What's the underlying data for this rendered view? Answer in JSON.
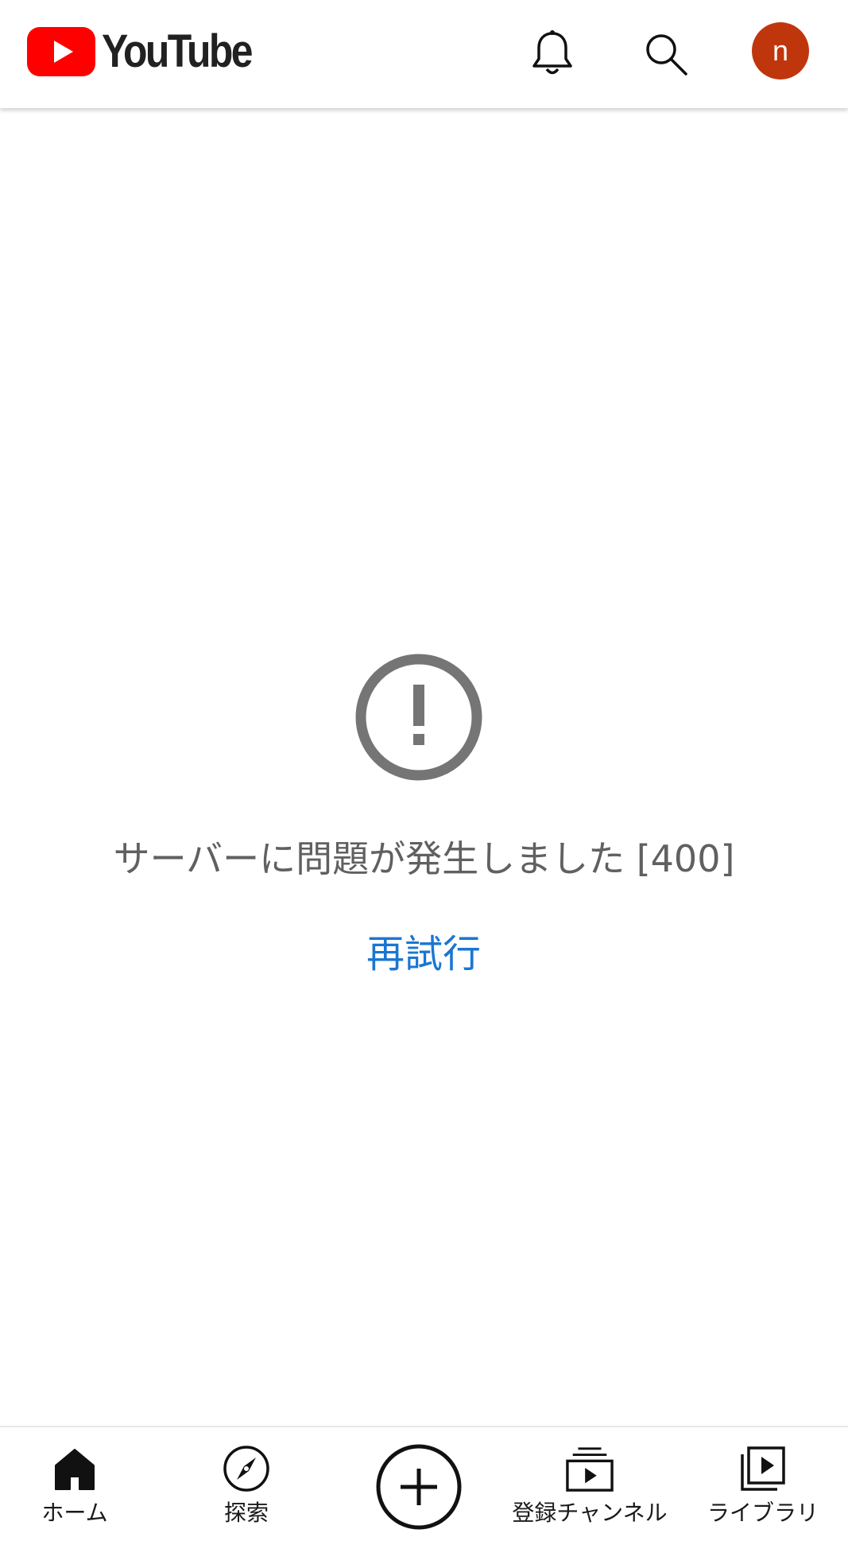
{
  "header": {
    "logo_text": "YouTube",
    "avatar_initial": "n",
    "brand_color": "#ff0000",
    "avatar_color": "#c0360c",
    "icons": [
      "bell-icon",
      "search-icon"
    ]
  },
  "error": {
    "icon": "exclamation-circle-icon",
    "message": "サーバーに問題が発生しました [400]",
    "retry_label": "再試行",
    "link_color": "#1976d2"
  },
  "bottom_nav": {
    "items": [
      {
        "label": "ホーム",
        "icon": "home-icon"
      },
      {
        "label": "探索",
        "icon": "compass-icon"
      },
      {
        "label": "",
        "icon": "create-plus-icon"
      },
      {
        "label": "登録チャンネル",
        "icon": "subscriptions-icon"
      },
      {
        "label": "ライブラリ",
        "icon": "library-icon"
      }
    ]
  }
}
